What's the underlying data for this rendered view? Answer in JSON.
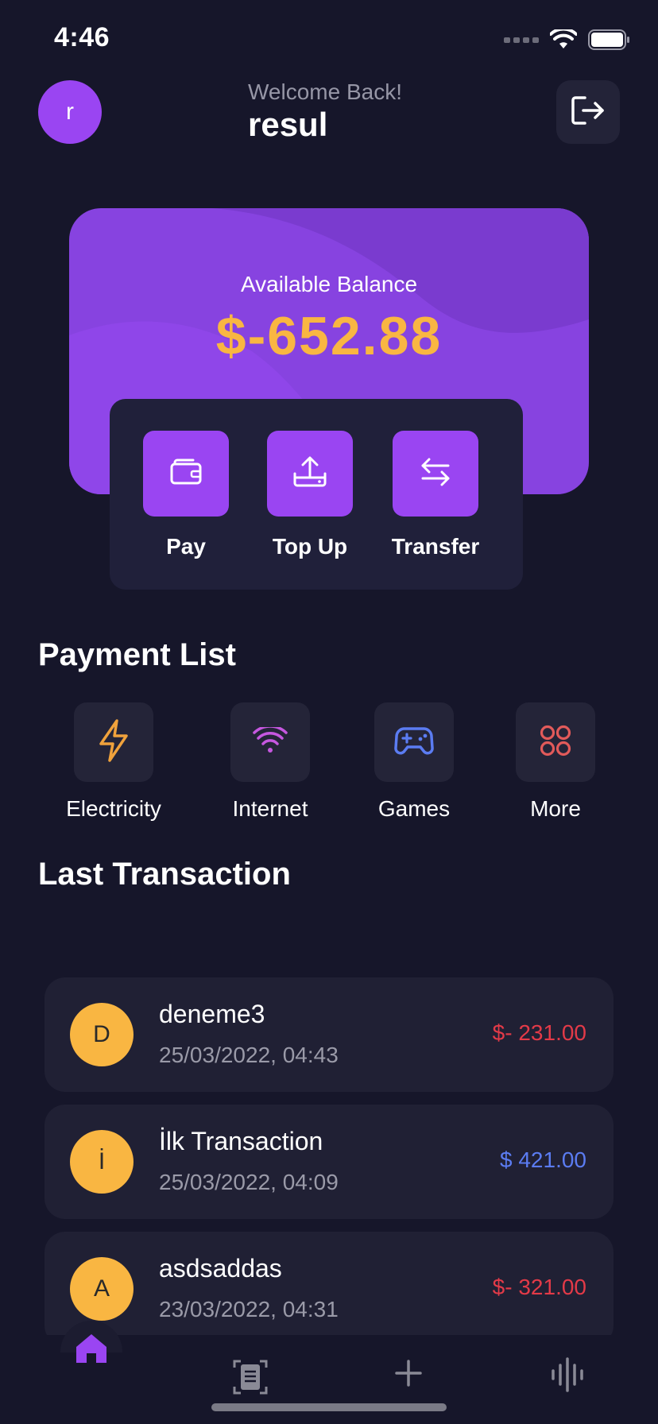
{
  "status_bar": {
    "time": "4:46",
    "icons": [
      "signal-icon",
      "wifi-icon",
      "battery-icon"
    ]
  },
  "header": {
    "avatar_letter": "r",
    "welcome": "Welcome Back!",
    "username": "resul",
    "logout_icon": "logout-icon"
  },
  "balance_card": {
    "label": "Available Balance",
    "amount": "$-652.88",
    "colors": {
      "card": "#8743e0",
      "amount": "#f9b642"
    }
  },
  "actions": [
    {
      "label": "Pay",
      "icon": "wallet-icon"
    },
    {
      "label": "Top Up",
      "icon": "upload-icon"
    },
    {
      "label": "Transfer",
      "icon": "transfer-icon"
    }
  ],
  "payment_list": {
    "title": "Payment List",
    "items": [
      {
        "label": "Electricity",
        "icon": "lightning-icon",
        "color": "#f0a23c"
      },
      {
        "label": "Internet",
        "icon": "wifi-icon",
        "color": "#c657e0"
      },
      {
        "label": "Games",
        "icon": "gamepad-icon",
        "color": "#5b7cf2"
      },
      {
        "label": "More",
        "icon": "grid-icon",
        "color": "#e25a5a"
      }
    ]
  },
  "transactions": {
    "title": "Last Transaction",
    "items": [
      {
        "initial": "D",
        "name": "deneme3",
        "date": "25/03/2022, 04:43",
        "amount": "$- 231.00",
        "type": "negative"
      },
      {
        "initial": "İ",
        "name": "İlk Transaction",
        "date": "25/03/2022, 04:09",
        "amount": "$ 421.00",
        "type": "positive"
      },
      {
        "initial": "A",
        "name": "asdsaddas",
        "date": "23/03/2022, 04:31",
        "amount": "$- 321.00",
        "type": "negative"
      }
    ]
  },
  "bottom_nav": {
    "items": [
      {
        "icon": "home-icon",
        "active": true
      },
      {
        "icon": "scan-icon",
        "active": false
      },
      {
        "icon": "plus-icon",
        "active": false
      },
      {
        "icon": "waveform-icon",
        "active": false
      }
    ],
    "active_color": "#9a45f2"
  }
}
